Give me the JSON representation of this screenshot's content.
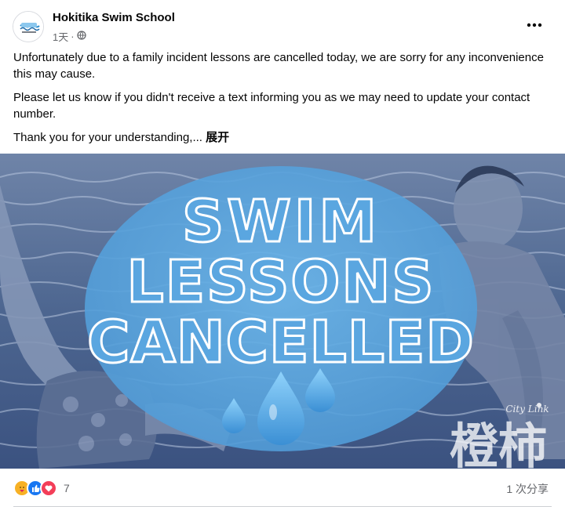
{
  "post": {
    "page_name": "Hokitika Swim School",
    "time": "1天",
    "separator": "·",
    "privacy_icon": "globe-icon",
    "more_icon": "more-dots-icon",
    "paragraph_1": "Unfortunately due to a family incident lessons are cancelled today, we are sorry for any inconvenience this may cause.",
    "paragraph_2": "Please let us know if you didn't receive a text informing you as we may need to update your contact number.",
    "paragraph_3": "Thank you for your understanding,...",
    "see_more": "展开"
  },
  "media": {
    "headline_line_1": "SWIM",
    "headline_line_2": "LESSONS",
    "headline_line_3": "CANCELLED",
    "watermark_brand": "City Link",
    "watermark_chars": "橙柿",
    "overlay_color": "#5fa8e0",
    "tint_color": "#3a5b8c"
  },
  "footer": {
    "reaction_icons": [
      "care-icon",
      "like-icon",
      "love-icon"
    ],
    "reaction_count": "7",
    "shares": "1 次分享"
  }
}
